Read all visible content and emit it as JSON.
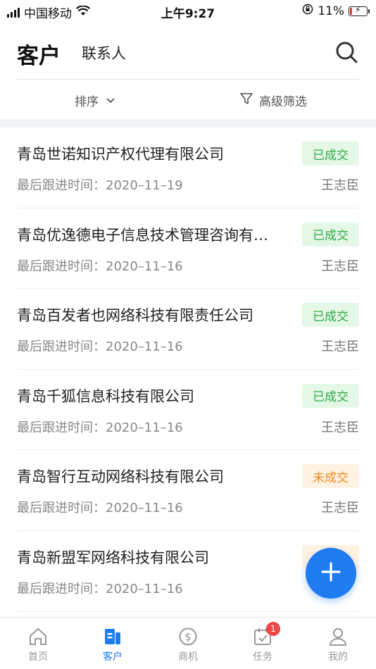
{
  "status_bar": {
    "carrier": "中国移动",
    "time": "上午9:27",
    "battery_percent": "11%"
  },
  "header": {
    "tab_active": "客户",
    "tab_inactive": "联系人"
  },
  "filter_bar": {
    "sort_label": "排序",
    "filter_label": "高级筛选"
  },
  "customers": [
    {
      "name": "青岛世诺知识产权代理有限公司",
      "status": "已成交",
      "last_follow": "最后跟进时间：2020–11–19",
      "owner": "王志臣"
    },
    {
      "name": "青岛优逸德电子信息技术管理咨询有…",
      "status": "已成交",
      "last_follow": "最后跟进时间：2020–11–16",
      "owner": "王志臣"
    },
    {
      "name": "青岛百发者也网络科技有限责任公司",
      "status": "已成交",
      "last_follow": "最后跟进时间：2020–11–16",
      "owner": "王志臣"
    },
    {
      "name": "青岛千狐信息科技有限公司",
      "status": "已成交",
      "last_follow": "最后跟进时间：2020–11–16",
      "owner": "王志臣"
    },
    {
      "name": "青岛智行互动网络科技有限公司",
      "status": "未成交",
      "last_follow": "最后跟进时间：2020–11–16",
      "owner": "王志臣"
    },
    {
      "name": "青岛新盟军网络科技有限公司",
      "status": "",
      "last_follow": "最后跟进时间：2020–11–16",
      "owner": ""
    }
  ],
  "tab_bar": {
    "home": "首页",
    "customers": "客户",
    "opportunities": "商机",
    "tasks": "任务",
    "tasks_badge": "1",
    "mine": "我的"
  },
  "colors": {
    "accent": "#1f7cf0",
    "done_text": "#2eab46",
    "done_bg": "#e5f8e8",
    "notdone_text": "#f08a1f",
    "notdone_bg": "#fff2e2",
    "badge_red": "#f04646"
  }
}
